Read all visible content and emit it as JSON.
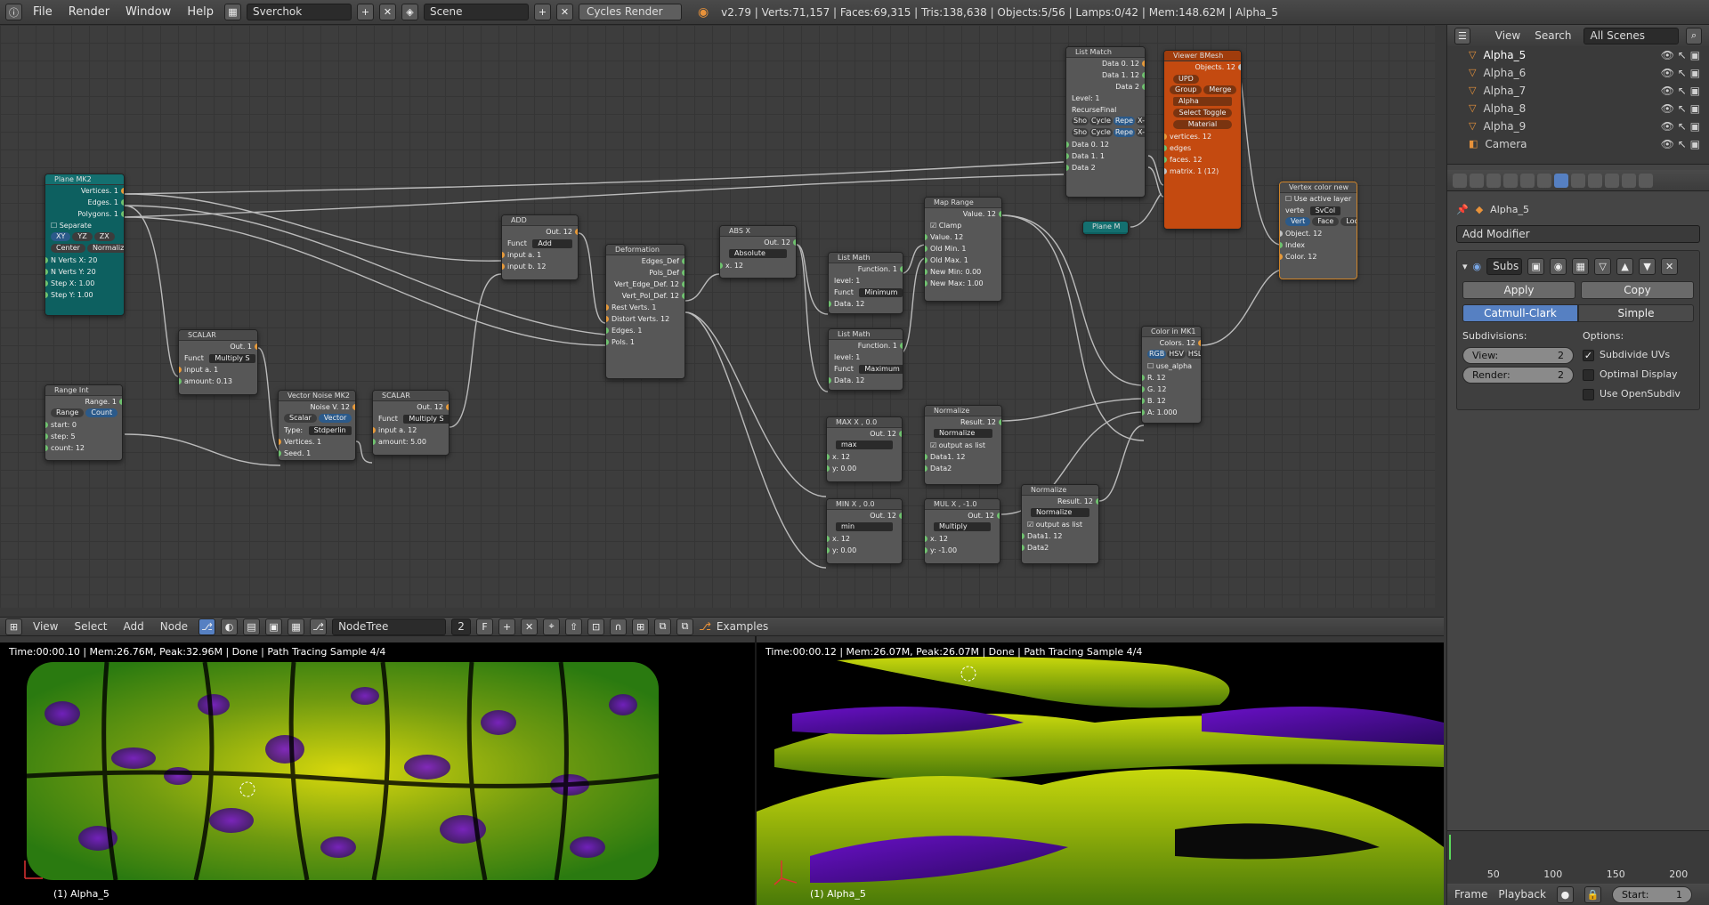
{
  "topbar": {
    "menus": [
      "File",
      "Render",
      "Window",
      "Help"
    ],
    "screen": "Sverchok",
    "scene": "Scene",
    "engine": "Cycles Render",
    "stats": "v2.79 | Verts:71,157 | Faces:69,315 | Tris:138,638 | Objects:5/56 | Lamps:0/42 | Mem:148.62M | Alpha_5"
  },
  "nodes": {
    "plane": {
      "title": "Plane MK2",
      "outs": [
        "Vertices. 1",
        "Edges. 1",
        "Polygons. 1"
      ],
      "separate": "Separate",
      "axes": [
        "XY",
        "YZ",
        "ZX"
      ],
      "opts": [
        "Center",
        "Normalize"
      ],
      "fields": [
        [
          "N Verts X:",
          "20"
        ],
        [
          "N Verts Y:",
          "20"
        ],
        [
          "Step X:",
          "1.00"
        ],
        [
          "Step Y:",
          "1.00"
        ]
      ]
    },
    "range": {
      "title": "Range Int",
      "out": "Range. 1",
      "modes": [
        "Range",
        "Count"
      ],
      "fields": [
        [
          "start:",
          "0"
        ],
        [
          "step:",
          "5"
        ],
        [
          "count:",
          "12"
        ]
      ]
    },
    "scalar1": {
      "title": "SCALAR",
      "out": "Out. 1",
      "funct": "Funct",
      "fn": "Multiply S",
      "in": "input a. 1",
      "amount": "amount:",
      "amountv": "0.13"
    },
    "vnoise": {
      "title": "Vector Noise MK2",
      "out": "Noise V. 12",
      "modes": [
        "Scalar",
        "Vector"
      ],
      "type": "Type:",
      "typev": "Stdperlin",
      "ins": [
        "Vertices. 1",
        "Seed. 1"
      ]
    },
    "scalar2": {
      "title": "SCALAR",
      "out": "Out. 12",
      "funct": "Funct",
      "fn": "Multiply S",
      "in": "input a. 12",
      "amount": "amount:",
      "amountv": "5.00"
    },
    "add": {
      "title": "ADD",
      "out": "Out. 12",
      "funct": "Funct",
      "fn": "Add",
      "ins": [
        "input a. 1",
        "input b. 12"
      ]
    },
    "deform": {
      "title": "Deformation",
      "outs": [
        "Edges_Def",
        "Pols_Def",
        "Vert_Edge_Def. 12",
        "Vert_Pol_Def. 12"
      ],
      "ins": [
        "Rest Verts. 1",
        "Distort Verts. 12",
        "Edges. 1",
        "Pols. 1"
      ]
    },
    "abs": {
      "title": "ABS X",
      "out": "Out. 12",
      "fn": "Absolute",
      "in": "x. 12"
    },
    "lm1": {
      "title": "List Math",
      "out": "Function. 1",
      "level": "level:",
      "levelv": "1",
      "funct": "Funct",
      "fn": "Minimum",
      "in": "Data. 12"
    },
    "lm2": {
      "title": "List Math",
      "out": "Function. 1",
      "level": "level:",
      "levelv": "1",
      "funct": "Funct",
      "fn": "Maximum",
      "in": "Data. 12"
    },
    "maprange": {
      "title": "Map Range",
      "out": "Value. 12",
      "clamp": "Clamp",
      "ins": [
        "Value. 12",
        "Old Min. 1",
        "Old Max. 1"
      ],
      "f1": "New Min:",
      "f1v": "0.00",
      "f2": "New Max:",
      "f2v": "1.00"
    },
    "listmatch": {
      "title": "List Match",
      "outs": [
        "Data 0. 12",
        "Data 1. 12",
        "Data 2"
      ],
      "level": "Level:",
      "levelv": "1",
      "mode": "RecurseFinal",
      "opts": [
        "Sho",
        "Cycle",
        "Repe",
        "X-Ref"
      ],
      "ins": [
        "Data 0. 12",
        "Data 1. 1",
        "Data 2"
      ]
    },
    "viewer": {
      "title": "Viewer BMesh",
      "out": "Objects. 12",
      "upd": "UPD",
      "group": "Group",
      "merge": "Merge",
      "name": "Alpha",
      "toggle": "Select Toggle",
      "material": "Material",
      "ins": [
        "vertices. 12",
        "edges",
        "faces. 12",
        "matrix. 1 (12)"
      ]
    },
    "vcol": {
      "title": "Vertex color new",
      "layer": "Use active layer",
      "verte": "verte",
      "vertev": "SvCol",
      "modes": [
        "Vert",
        "Face",
        "Loop"
      ],
      "ins": [
        "Object. 12",
        "Index",
        "Color. 12"
      ]
    },
    "planem": {
      "title": "Plane M"
    },
    "colorin": {
      "title": "Color in MK1",
      "out": "Colors. 12",
      "modes": [
        "RGB",
        "HSV",
        "HSL"
      ],
      "alpha": "use_alpha",
      "ins": [
        "R. 12",
        "G. 12",
        "B. 12"
      ],
      "a": "A:",
      "av": "1.000"
    },
    "max": {
      "title": "MAX X , 0.0",
      "out": "Out. 12",
      "fn": "max",
      "in": "x. 12",
      "y": "y:",
      "yv": "0.00"
    },
    "min": {
      "title": "MIN X , 0.0",
      "out": "Out. 12",
      "fn": "min",
      "in": "x. 12",
      "y": "y:",
      "yv": "0.00"
    },
    "mul": {
      "title": "MUL X , -1.0",
      "out": "Out. 12",
      "fn": "Multiply",
      "in": "x. 12",
      "y": "y:",
      "yv": "-1.00"
    },
    "norm1": {
      "title": "Normalize",
      "out": "Result. 12",
      "fn": "Normalize",
      "opt": "output as list",
      "ins": [
        "Data1. 12",
        "Data2"
      ]
    },
    "norm2": {
      "title": "Normalize",
      "out": "Result. 12",
      "fn": "Normalize",
      "opt": "output as list",
      "ins": [
        "Data1. 12",
        "Data2"
      ]
    }
  },
  "nodeheader": {
    "menus": [
      "View",
      "Select",
      "Add",
      "Node"
    ],
    "tree": "NodeTree",
    "users": "2",
    "fake": "F",
    "examples": "Examples"
  },
  "viewports": {
    "left": {
      "info": "Time:00:00.10 | Mem:26.76M, Peak:32.96M | Done | Path Tracing Sample 4/4",
      "label": "(1) Alpha_5"
    },
    "right": {
      "info": "Time:00:00.12 | Mem:26.07M, Peak:26.07M | Done | Path Tracing Sample 4/4",
      "label": "(1) Alpha_5"
    }
  },
  "outliner": {
    "menus": [
      "View",
      "Search"
    ],
    "scope": "All Scenes",
    "rows": [
      "Alpha_5",
      "Alpha_6",
      "Alpha_7",
      "Alpha_8",
      "Alpha_9",
      "Camera"
    ]
  },
  "properties": {
    "object": "Alpha_5",
    "add_modifier": "Add Modifier",
    "mod_name": "Subs",
    "apply": "Apply",
    "copy": "Copy",
    "types": [
      "Catmull-Clark",
      "Simple"
    ],
    "subdivisions": "Subdivisions:",
    "options": "Options:",
    "view": "View:",
    "viewv": "2",
    "render": "Render:",
    "renderv": "2",
    "checks": [
      {
        "label": "Subdivide UVs",
        "on": true
      },
      {
        "label": "Optimal Display",
        "on": false
      },
      {
        "label": "Use OpenSubdiv",
        "on": false
      }
    ]
  },
  "timeline": {
    "ticks": [
      "50",
      "100",
      "150",
      "200"
    ],
    "menus": [
      "Frame",
      "Playback"
    ],
    "start": "Start:",
    "startv": "1"
  }
}
